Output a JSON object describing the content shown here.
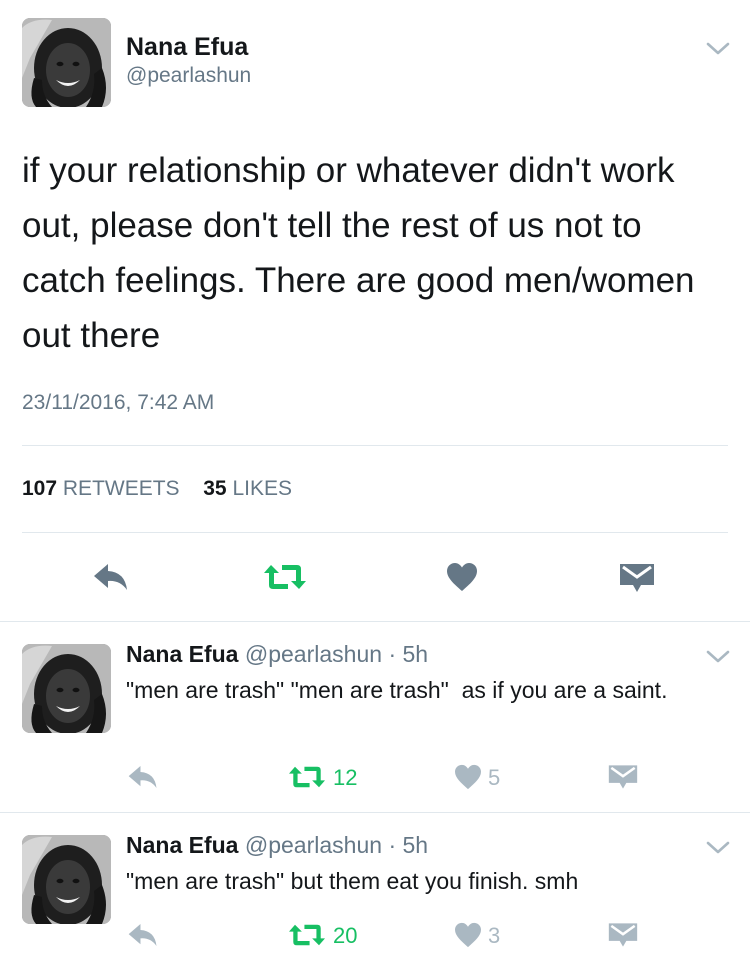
{
  "colors": {
    "text": "#14171a",
    "muted": "#657786",
    "retweet_green": "#17bf63",
    "icon_grey": "#657786",
    "icon_light": "#aab8c2",
    "divider": "#e1e8ed"
  },
  "main_tweet": {
    "author_name": "Nana Efua",
    "author_handle": "@pearlashun",
    "text": "if your relationship or whatever didn't work out, please don't tell the rest of us not to catch feelings. There are good men/women out there",
    "timestamp": "23/11/2016, 7:42 AM",
    "retweet_count": "107",
    "retweet_label": "RETWEETS",
    "like_count": "35",
    "like_label": "LIKES",
    "icons": [
      "reply-icon",
      "retweet-icon",
      "heart-icon",
      "direct-message-icon"
    ]
  },
  "replies": [
    {
      "author_name": "Nana Efua",
      "author_handle": "@pearlashun",
      "separator": "·",
      "time": "5h",
      "text": "\"men are trash\" \"men are trash\"  as if you are a saint.",
      "retweet_count": "12",
      "like_count": "5"
    },
    {
      "author_name": "Nana Efua",
      "author_handle": "@pearlashun",
      "separator": "·",
      "time": "5h",
      "text": "\"men are trash\" but them eat you finish. smh",
      "retweet_count": "20",
      "like_count": "3"
    }
  ]
}
